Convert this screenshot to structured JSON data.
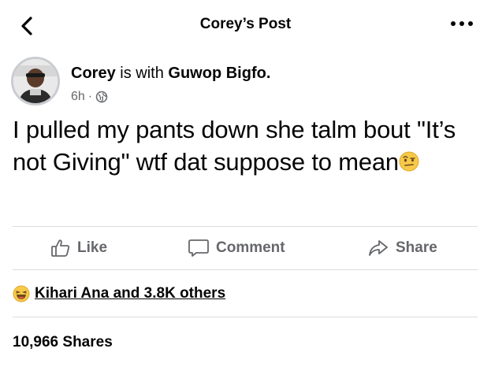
{
  "header": {
    "title": "Corey’s Post",
    "back_icon": "chevron-left-icon",
    "more_icon": "more-horizontal-icon"
  },
  "author": {
    "name": "Corey",
    "with_text": "is with",
    "tagged": "Guwop Bigfo.",
    "time": "6h",
    "separator": "·",
    "privacy_icon": "globe-icon"
  },
  "post": {
    "text": "I pulled my pants down she talm bout \"It’s not Giving\" wtf dat suppose to mean",
    "emoji": "raised-eyebrow-emoji"
  },
  "actions": [
    {
      "label": "Like",
      "icon": "thumbs-up-icon"
    },
    {
      "label": "Comment",
      "icon": "comment-icon"
    },
    {
      "label": "Share",
      "icon": "share-icon"
    }
  ],
  "reactions": {
    "text": "Kihari Ana and 3.8K others",
    "emoji": "laughing-emoji"
  },
  "shares": {
    "text": "10,966 Shares"
  },
  "colors": {
    "text": "#050505",
    "secondary": "#65676b",
    "divider": "#dadde1",
    "emoji_yellow": "#f7c948"
  }
}
